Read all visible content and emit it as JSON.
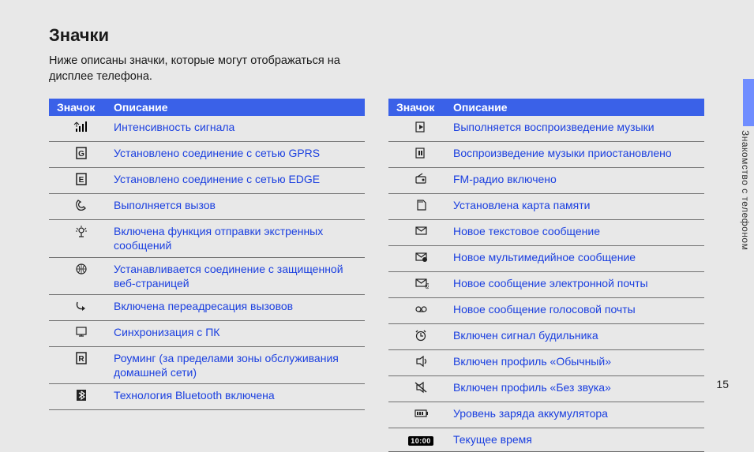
{
  "title": "Значки",
  "intro": "Ниже описаны значки, которые могут отображаться на дисплее телефона.",
  "header": {
    "icon": "Значок",
    "desc": "Описание"
  },
  "left": [
    {
      "icon": "signal-icon",
      "desc": "Интенсивность сигнала"
    },
    {
      "icon": "gprs-icon",
      "desc": "Установлено соединение с сетью GPRS"
    },
    {
      "icon": "edge-icon",
      "desc": "Установлено соединение с сетью EDGE"
    },
    {
      "icon": "call-icon",
      "desc": "Выполняется вызов"
    },
    {
      "icon": "sos-icon",
      "desc": "Включена функция отправки экстренных сообщений"
    },
    {
      "icon": "secure-web-icon",
      "desc": "Устанавливается соединение с защищенной веб-страницей"
    },
    {
      "icon": "forward-icon",
      "desc": "Включена переадресация вызовов"
    },
    {
      "icon": "pc-sync-icon",
      "desc": "Синхронизация с ПК"
    },
    {
      "icon": "roaming-icon",
      "desc": "Роуминг (за пределами зоны обслуживания домашней сети)"
    },
    {
      "icon": "bluetooth-icon",
      "desc": "Технология Bluetooth включена"
    }
  ],
  "right": [
    {
      "icon": "music-play-icon",
      "desc": "Выполняется воспроизведение музыки"
    },
    {
      "icon": "music-pause-icon",
      "desc": "Воспроизведение музыки приостановлено"
    },
    {
      "icon": "fm-radio-icon",
      "desc": "FM-радио включено"
    },
    {
      "icon": "sdcard-icon",
      "desc": "Установлена карта памяти"
    },
    {
      "icon": "sms-icon",
      "desc": "Новое текстовое сообщение"
    },
    {
      "icon": "mms-icon",
      "desc": "Новое мультимедийное сообщение"
    },
    {
      "icon": "email-icon",
      "desc": "Новое сообщение электронной почты"
    },
    {
      "icon": "voicemail-icon",
      "desc": "Новое сообщение голосовой почты"
    },
    {
      "icon": "alarm-icon",
      "desc": "Включен сигнал будильника"
    },
    {
      "icon": "profile-normal-icon",
      "desc": "Включен профиль «Обычный»"
    },
    {
      "icon": "profile-silent-icon",
      "desc": "Включен профиль «Без звука»"
    },
    {
      "icon": "battery-icon",
      "desc": "Уровень заряда аккумулятора"
    },
    {
      "icon": "clock-icon",
      "desc": "Текущее время",
      "icon_text": "10:00"
    }
  ],
  "side_label": "Знакомство с телефоном",
  "page_number": "15"
}
